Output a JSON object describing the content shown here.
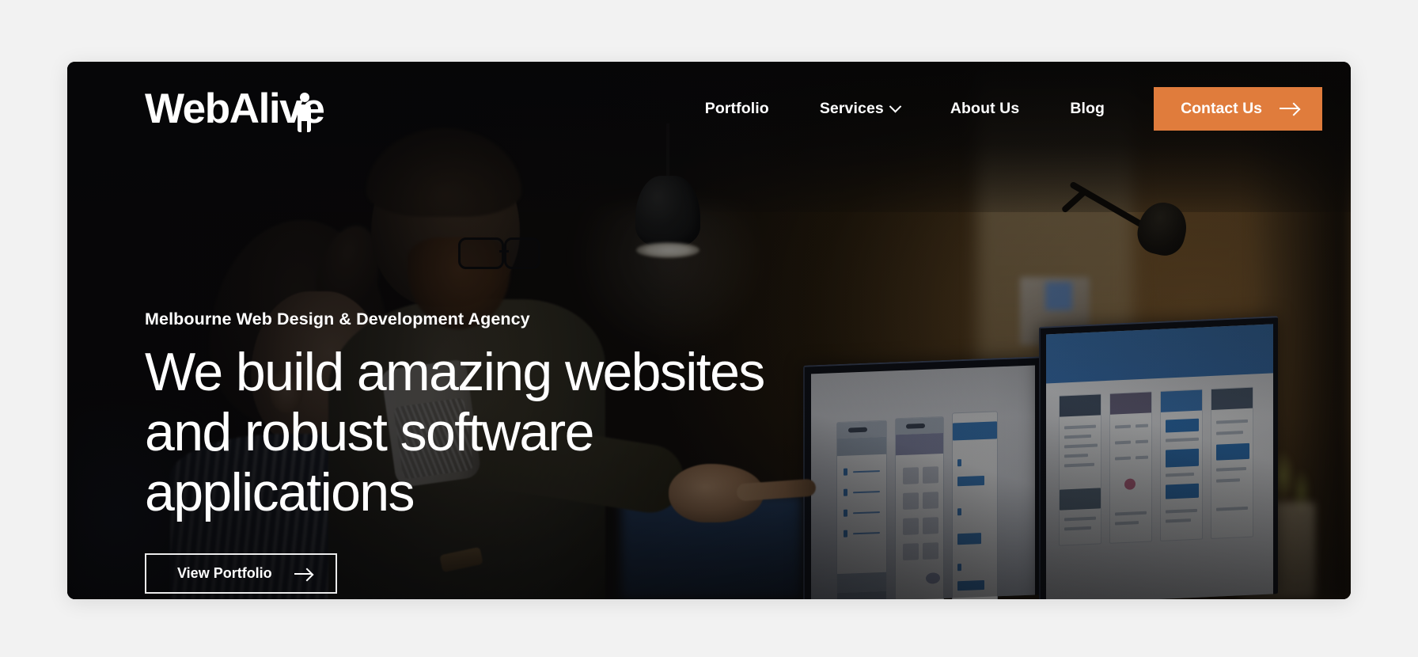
{
  "site": {
    "logo_text": "WebAlive",
    "logo_icon": "person-figure-icon"
  },
  "nav": {
    "items": [
      {
        "label": "Portfolio",
        "has_dropdown": false
      },
      {
        "label": "Services",
        "has_dropdown": true,
        "icon": "chevron-down-icon"
      },
      {
        "label": "About Us",
        "has_dropdown": false
      },
      {
        "label": "Blog",
        "has_dropdown": false
      }
    ],
    "cta": {
      "label": "Contact Us",
      "icon": "arrow-right-icon",
      "background": "#e07c3c",
      "text_color": "#ffffff"
    }
  },
  "hero": {
    "eyebrow": "Melbourne Web Design & Development Agency",
    "headline_lines": [
      "We build amazing websites",
      "and robust software",
      "applications"
    ],
    "cta": {
      "label": "View Portfolio",
      "icon": "arrow-right-icon",
      "style": "outline",
      "border_color": "#ffffff"
    },
    "background_description": "Dark office photo: two colleagues reviewing UI wireframes on dual monitors"
  },
  "theme": {
    "page_background": "#f2f2f2",
    "card_background": "#120d08",
    "accent": "#e07c3c",
    "text_on_dark": "#ffffff"
  }
}
